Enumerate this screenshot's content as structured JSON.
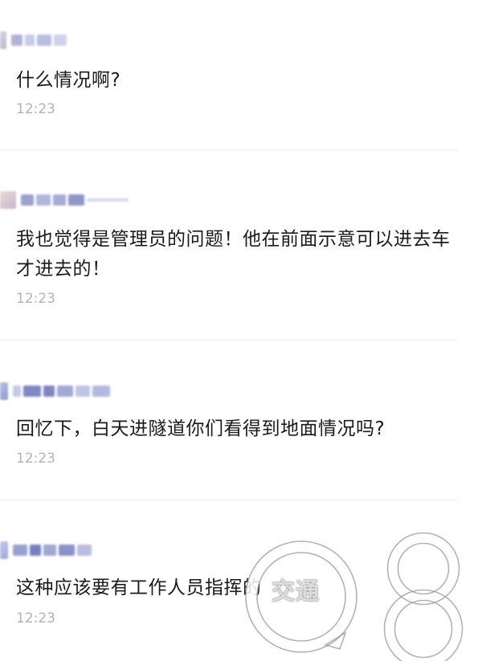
{
  "comments": [
    {
      "text": "什么情况啊?",
      "time": "12:23"
    },
    {
      "text": "我也觉得是管理员的问题！他在前面示意可以进去车才进去的！",
      "time": "12:23"
    },
    {
      "text": "回忆下，白天进隧道你们看得到地面情况吗?",
      "time": "12:23"
    },
    {
      "text": "这种应该要有工作人员指挥的",
      "time": "12:23"
    }
  ],
  "watermark": {
    "text": "交通"
  },
  "colors": {
    "text": "#1b1b1b",
    "time": "#b4b4b4",
    "divider": "#eeeeee",
    "background": "#ffffff"
  }
}
